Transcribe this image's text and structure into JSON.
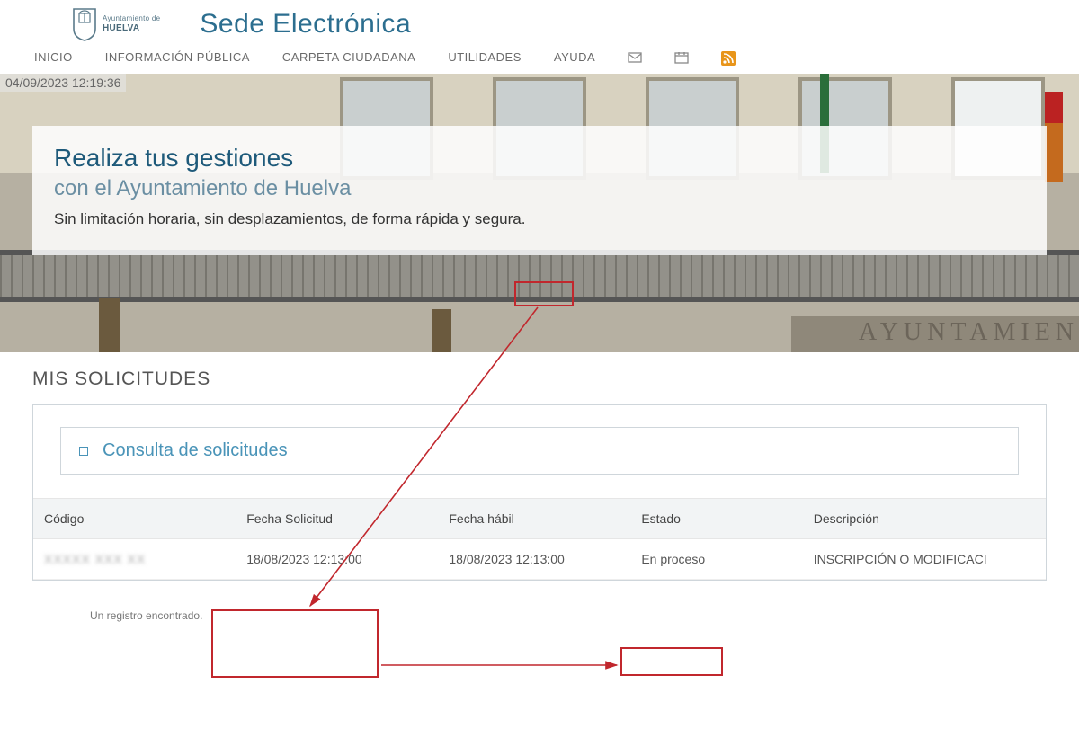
{
  "header": {
    "logo_top": "Ayuntamiento de",
    "logo_bottom": "HUELVA",
    "site_title": "Sede Electrónica"
  },
  "nav": {
    "items": [
      {
        "label": "INICIO"
      },
      {
        "label": "INFORMACIÓN PÚBLICA"
      },
      {
        "label": "CARPETA CIUDADANA"
      },
      {
        "label": "UTILIDADES"
      },
      {
        "label": "AYUDA"
      }
    ],
    "icons": [
      "mail-icon",
      "calendar-icon",
      "rss-icon"
    ]
  },
  "hero": {
    "timestamp": "04/09/2023 12:19:36",
    "h1": "Realiza tus gestiones",
    "h2": "con el Ayuntamiento de Huelva",
    "p_before": "Sin limitación horaria, sin desplazamientos, de forma ",
    "p_highlight": "rápida",
    "p_after": " y segura.",
    "bg_sign": "AYUNTAMIEN"
  },
  "section": {
    "title": "MIS SOLICITUDES",
    "consult_label": "Consulta de solicitudes"
  },
  "table": {
    "headers": {
      "codigo": "Código",
      "fecha_solicitud": "Fecha Solicitud",
      "fecha_habil": "Fecha hábil",
      "estado": "Estado",
      "descripcion": "Descripción"
    },
    "rows": [
      {
        "codigo": "XXXXX XXX XX",
        "fecha_solicitud": "18/08/2023 12:13:00",
        "fecha_habil": "18/08/2023 12:13:00",
        "estado": "En proceso",
        "descripcion": "INSCRIPCIÓN O MODIFICACI"
      }
    ],
    "footer": "Un registro encontrado."
  }
}
